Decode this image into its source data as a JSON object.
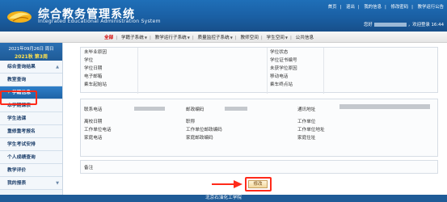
{
  "header": {
    "title": "综合教务管理系统",
    "subtitle": "Integrated Educational Administration System",
    "top_links": [
      "首页",
      "退出",
      "我的信息",
      "修改密码",
      "教学运行公告"
    ],
    "welcome_prefix": "您好",
    "welcome_suffix": "，欢迎登录 16:44"
  },
  "menubar": {
    "items": [
      {
        "label": "全部",
        "active": true
      },
      {
        "label": "学籍子系统",
        "active": false
      },
      {
        "label": "教学运行子系统",
        "active": false
      },
      {
        "label": "质量监控子系统",
        "active": false
      },
      {
        "label": "教师空间",
        "active": false
      },
      {
        "label": "学生空间",
        "active": false
      },
      {
        "label": "公共信息",
        "active": false
      }
    ]
  },
  "sidebar": {
    "date_line": "2021年09月26日 周日",
    "semester": "2021秋 第3周",
    "items": [
      {
        "label": "综合查询结果"
      },
      {
        "label": "教室查询"
      },
      {
        "label": "学籍信息",
        "active": true
      },
      {
        "label": "本学期课表"
      },
      {
        "label": "学生选课"
      },
      {
        "label": "重修重考报名"
      },
      {
        "label": "学生考试安排"
      },
      {
        "label": "个人成绩查询"
      },
      {
        "label": "教学评价"
      },
      {
        "label": "我的报表"
      }
    ]
  },
  "info_panel1": {
    "left_labels": [
      "未毕业原因",
      "学位",
      "学位日期",
      "电子邮箱",
      "乘车起始站"
    ],
    "right_labels": [
      "学位状态",
      "学位证书编号",
      "未获学位原因",
      "移动电话",
      "乘车终点站"
    ]
  },
  "info_panel2": {
    "row1": {
      "a": "联系电话",
      "b": "邮政编码",
      "c": "通讯地址"
    },
    "row2": {
      "a": "离校日期",
      "b": "职称",
      "c": "工作单位"
    },
    "row3": {
      "a": "工作单位电话",
      "b": "工作单位邮政编码",
      "c": "工作单位地址"
    },
    "row4": {
      "a": "家庭电话",
      "b": "家庭邮政编码",
      "c": "家庭住址"
    }
  },
  "remark": {
    "label": "备注"
  },
  "modify_button": {
    "label": "修改"
  },
  "footer": {
    "text": "北京石油化工学院"
  }
}
